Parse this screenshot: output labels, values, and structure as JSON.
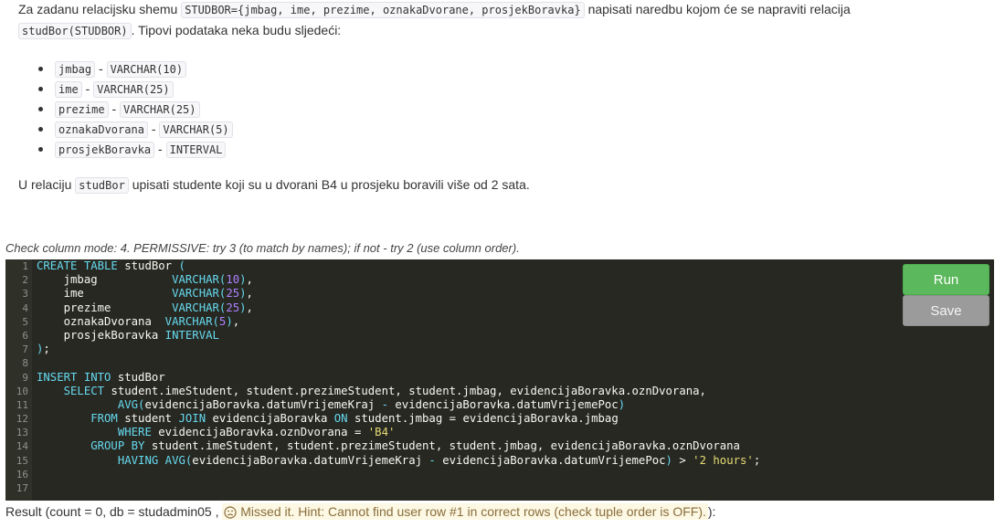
{
  "intro": {
    "p1": "Za zadanu relacijsku shemu",
    "schema": "STUDBOR={jmbag, ime, prezime, oznakaDvorane, prosjekBoravka}",
    "p2": "napisati naredbu kojom će se napraviti relacija",
    "relation": "studBor(STUDBOR)",
    "p3": ". Tipovi podataka neka budu sljedeći:"
  },
  "types": [
    {
      "name": "jmbag",
      "type": "VARCHAR(10)"
    },
    {
      "name": "ime",
      "type": "VARCHAR(25)"
    },
    {
      "name": "prezime",
      "type": "VARCHAR(25)"
    },
    {
      "name": "oznakaDvorana",
      "type": "VARCHAR(5)"
    },
    {
      "name": "prosjekBoravka",
      "type": "INTERVAL"
    }
  ],
  "type_separator": "-",
  "task": {
    "p1": "U relaciju",
    "relation": "studBor",
    "p2": "upisati studente koji su u dvorani B4 u prosjeku boravili više od 2 sata."
  },
  "mode_text": "Check column mode: 4. PERMISSIVE: try 3 (to match by names); if not - try 2 (use column order).",
  "editor": {
    "line_numbers": [
      "1",
      "2",
      "3",
      "4",
      "5",
      "6",
      "7",
      "8",
      "9",
      "10",
      "11",
      "12",
      "13",
      "14",
      "15",
      "16",
      "17"
    ],
    "run_label": "Run",
    "save_label": "Save"
  },
  "result": {
    "prefix": "Result (count = 0, db = studadmin05 ,",
    "hint": "Missed it. Hint: Cannot find user row #1 in correct rows (check tuple order is OFF).",
    "suffix": "):"
  },
  "colors": {
    "run": "#5cb85c",
    "save": "#9b9b9b",
    "editor_bg": "#272822",
    "keyword": "#66d9ef",
    "number": "#ae81ff",
    "string": "#e6db74"
  }
}
